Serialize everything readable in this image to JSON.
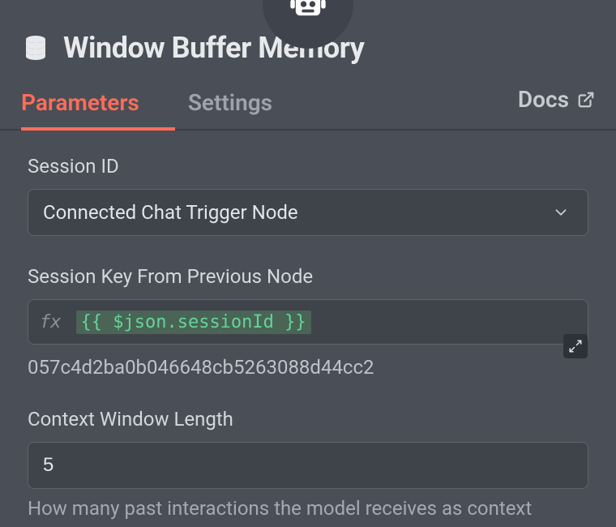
{
  "header": {
    "title": "Window Buffer Memory"
  },
  "tabs": {
    "parameters": "Parameters",
    "settings": "Settings",
    "docs": "Docs"
  },
  "fields": {
    "sessionId": {
      "label": "Session ID",
      "value": "Connected Chat Trigger Node"
    },
    "sessionKey": {
      "label": "Session Key From Previous Node",
      "fx": "fx",
      "expression": "{{ $json.sessionId }}",
      "resolved": "057c4d2ba0b046648cb5263088d44cc2"
    },
    "contextWindow": {
      "label": "Context Window Length",
      "value": "5",
      "help": "How many past interactions the model receives as context"
    }
  }
}
